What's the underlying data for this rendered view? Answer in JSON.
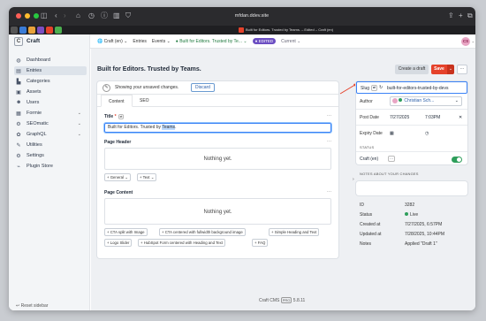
{
  "browser": {
    "url": "mfdan.ddev.site",
    "active_tab": "Built for Editors. Trusted by Teams. – Edited – Craft (en)",
    "colors": {
      "close": "#ff5f57",
      "min": "#febc2e",
      "max": "#28c840"
    }
  },
  "header": {
    "brand_letter": "C",
    "brand": "Craft",
    "site": "Craft (en)",
    "crumb_entries": "Entries",
    "crumb_events": "Events",
    "crumb_entry": "Built for Editors. Trusted by Te...",
    "edited": "EDITED",
    "current": "Current",
    "avatar": "CS"
  },
  "sidebar": {
    "items": [
      {
        "label": "Dashboard",
        "icon": "gauge-icon",
        "glyph": "◍"
      },
      {
        "label": "Entries",
        "icon": "entries-icon",
        "glyph": "▤",
        "active": true
      },
      {
        "label": "Categories",
        "icon": "categories-icon",
        "glyph": "▙"
      },
      {
        "label": "Assets",
        "icon": "assets-icon",
        "glyph": "▣"
      },
      {
        "label": "Users",
        "icon": "users-icon",
        "glyph": "👥"
      },
      {
        "label": "Formie",
        "icon": "formie-icon",
        "glyph": "▦"
      },
      {
        "label": "SEOmatic",
        "icon": "seomatic-icon",
        "glyph": "⚙"
      },
      {
        "label": "GraphQL",
        "icon": "graphql-icon",
        "glyph": "✿"
      },
      {
        "label": "Utilities",
        "icon": "utilities-icon",
        "glyph": "🔧"
      },
      {
        "label": "Settings",
        "icon": "settings-icon",
        "glyph": "⚙"
      },
      {
        "label": "Plugin Store",
        "icon": "plug-icon",
        "glyph": "⌁"
      }
    ],
    "bottom": "Reset sidebar"
  },
  "main": {
    "title": "Built for Editors. Trusted by Teams.",
    "create_draft": "Create a draft",
    "save": "Save",
    "notice": "Showing your unsaved changes.",
    "discard": "Discard",
    "tab_content": "Content",
    "tab_seo": "SEO",
    "title_label": "Title",
    "title_value_a": "Built for Editors. Trusted by ",
    "title_value_b": "Teams",
    "title_value_c": ".",
    "page_header": "Page Header",
    "nothing_yet": "Nothing yet.",
    "general": "+ General",
    "text": "+ Text",
    "page_content": "Page Content",
    "add_buttons": [
      "+ CTA split with Image",
      "+ CTA centered with fullwidth background image",
      "+ Simple Heading and Text",
      "+ Logo Slider",
      "+ HubSpot Form centered with Heading and Text",
      "+ FAQ"
    ],
    "footer": "Craft CMS",
    "footer_edition": "PRO",
    "footer_version": "5.8.11"
  },
  "panel": {
    "slug_label": "Slug",
    "slug_value": "built-for-editors-trusted-by-devs",
    "author_label": "Author",
    "author_value": "Christian Sch...",
    "post_date_label": "Post Date",
    "post_date": "7/27/2025",
    "post_time": "7:03PM",
    "expiry_label": "Expiry Date",
    "status_head": "STATUS",
    "status_site": "Craft (en)",
    "notes_head": "NOTES ABOUT YOUR CHANGES",
    "meta": [
      {
        "k": "ID",
        "v": "3282"
      },
      {
        "k": "Status",
        "v": "Live"
      },
      {
        "k": "Created at",
        "v": "7/27/2025, 6:57PM"
      },
      {
        "k": "Updated at",
        "v": "7/28/2025, 10:44PM"
      },
      {
        "k": "Notes",
        "v": "Applied \"Draft 1\""
      }
    ]
  }
}
